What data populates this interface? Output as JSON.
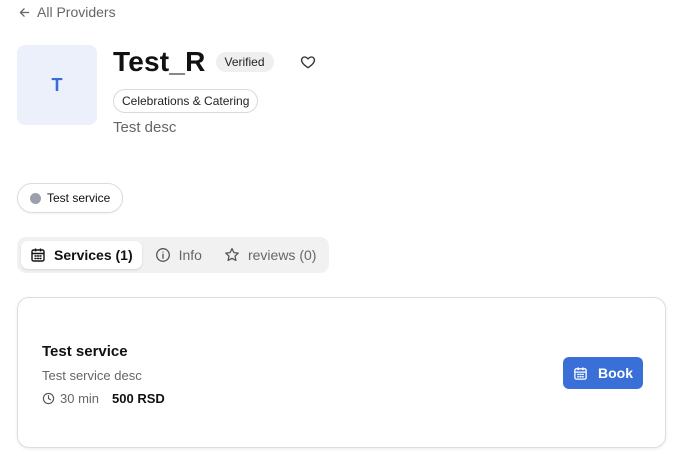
{
  "nav": {
    "back_label": "All Providers"
  },
  "provider": {
    "initial": "T",
    "name": "Test_R",
    "verified_label": "Verified",
    "category": "Celebrations & Catering",
    "description": "Test desc"
  },
  "service_filter": {
    "label": "Test service"
  },
  "tabs": [
    {
      "label": "Services (1)",
      "icon": "calendar-icon",
      "active": true
    },
    {
      "label": "Info",
      "icon": "info-icon",
      "active": false
    },
    {
      "label": "reviews (0)",
      "icon": "star-icon",
      "active": false
    }
  ],
  "service": {
    "title": "Test service",
    "description": "Test service desc",
    "duration": "30 min",
    "price": "500 RSD",
    "book_label": "Book"
  },
  "colors": {
    "accent": "#3b6fd8",
    "avatar_bg": "#ebf0fb",
    "dot": "#9aa1ab"
  }
}
